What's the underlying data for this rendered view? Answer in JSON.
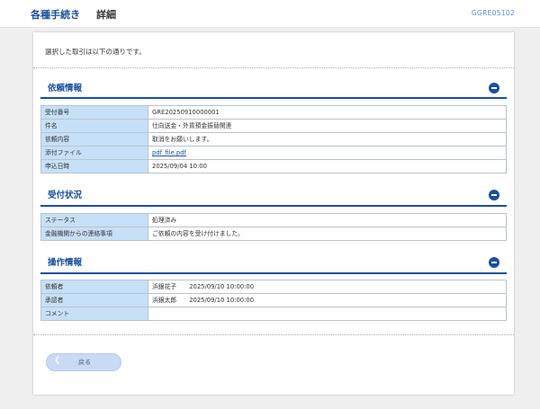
{
  "header": {
    "title": "各種手続き",
    "subtitle": "詳細",
    "screen_id": "GGRE05102"
  },
  "intro_text": "選択した取引は以下の通りです。",
  "sections": {
    "request": {
      "title": "依頼情報",
      "rows": [
        {
          "label": "受付番号",
          "value": "GRE20250910000001"
        },
        {
          "label": "件名",
          "value": "仕向送金・外貨預金振替関連"
        },
        {
          "label": "依頼内容",
          "value": "取消をお願いします。"
        },
        {
          "label": "添付ファイル",
          "value": "pdf_file.pdf"
        },
        {
          "label": "申込日時",
          "value": "2025/09/04 10:00"
        }
      ]
    },
    "status": {
      "title": "受付状況",
      "rows": [
        {
          "label": "ステータス",
          "value": "処理済み"
        },
        {
          "label": "金融機関からの連絡事項",
          "value": "ご依頼の内容を受け付けました。"
        }
      ]
    },
    "operation": {
      "title": "操作情報",
      "rows": [
        {
          "label": "依頼者",
          "name": "浜銀花子",
          "datetime": "2025/09/10 10:00:00"
        },
        {
          "label": "承認者",
          "name": "浜銀太郎",
          "datetime": "2025/09/10 10:00:00"
        },
        {
          "label": "コメント",
          "value": ""
        }
      ]
    }
  },
  "back_button": {
    "label": "戻る",
    "icon": "chevron-left-icon"
  },
  "colors": {
    "accent": "#1a4fa0",
    "label_bg": "#c6e0f7",
    "button_bg": "#c8daf5",
    "page_bg": "#efefef"
  }
}
